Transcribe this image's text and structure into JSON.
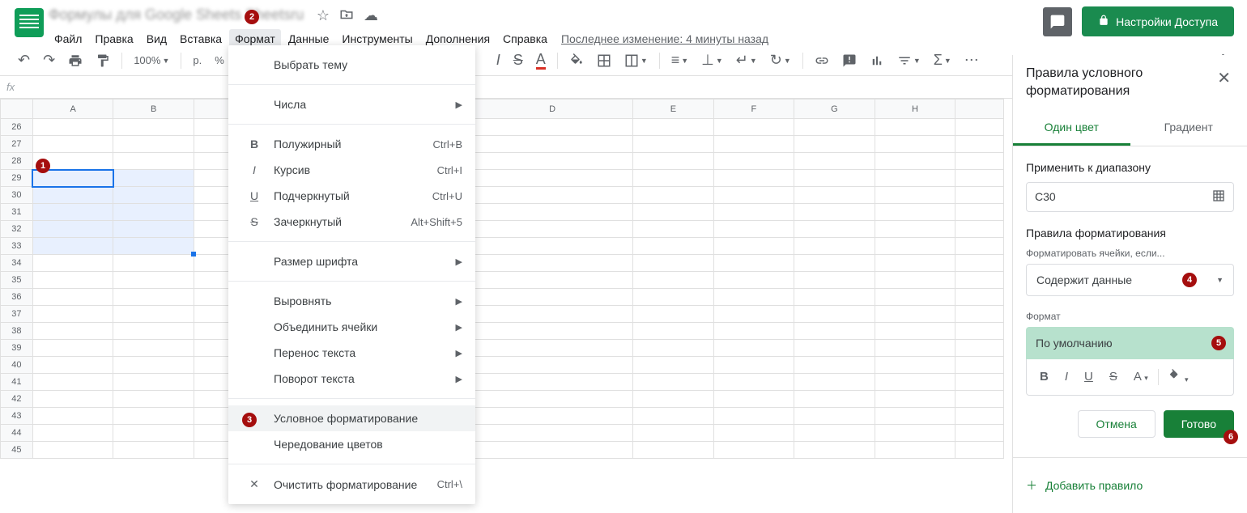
{
  "header": {
    "doc_title_blurred": "Формулы для Google Sheets Sheetsru",
    "star_icon": "☆",
    "move_icon": "⊕",
    "cloud_icon": "☁",
    "share_label": "Настройки Доступа",
    "last_edit": "Последнее изменение: 4 минуты назад"
  },
  "menubar": [
    "Файл",
    "Правка",
    "Вид",
    "Вставка",
    "Формат",
    "Данные",
    "Инструменты",
    "Дополнения",
    "Справка"
  ],
  "toolbar": {
    "zoom": "100%",
    "currency": "р.",
    "percent": "%"
  },
  "columns": [
    "A",
    "B",
    "",
    "D",
    "E",
    "F",
    "G",
    "H"
  ],
  "rows": [
    "26",
    "27",
    "28",
    "29",
    "30",
    "31",
    "32",
    "33",
    "34",
    "35",
    "36",
    "37",
    "38",
    "39",
    "40",
    "41",
    "42",
    "43",
    "44",
    "45"
  ],
  "format_menu": {
    "items": [
      {
        "label": "Выбрать тему",
        "icon": "",
        "shortcut": "",
        "arrow": false
      },
      {
        "sep": true
      },
      {
        "label": "Числа",
        "icon": "",
        "shortcut": "",
        "arrow": true
      },
      {
        "sep": true
      },
      {
        "label": "Полужирный",
        "icon": "B",
        "bold": true,
        "shortcut": "Ctrl+B",
        "arrow": false
      },
      {
        "label": "Курсив",
        "icon": "I",
        "italic": true,
        "shortcut": "Ctrl+I",
        "arrow": false
      },
      {
        "label": "Подчеркнутый",
        "icon": "U",
        "underline": true,
        "shortcut": "Ctrl+U",
        "arrow": false
      },
      {
        "label": "Зачеркнутый",
        "icon": "S",
        "strike": true,
        "shortcut": "Alt+Shift+5",
        "arrow": false
      },
      {
        "sep": true
      },
      {
        "label": "Размер шрифта",
        "icon": "",
        "shortcut": "",
        "arrow": true
      },
      {
        "sep": true
      },
      {
        "label": "Выровнять",
        "icon": "",
        "shortcut": "",
        "arrow": true
      },
      {
        "label": "Объединить ячейки",
        "icon": "",
        "shortcut": "",
        "arrow": true
      },
      {
        "label": "Перенос текста",
        "icon": "",
        "shortcut": "",
        "arrow": true
      },
      {
        "label": "Поворот текста",
        "icon": "",
        "shortcut": "",
        "arrow": true
      },
      {
        "sep": true
      },
      {
        "label": "Условное форматирование",
        "icon": "",
        "shortcut": "",
        "arrow": false,
        "hover": true
      },
      {
        "label": "Чередование цветов",
        "icon": "",
        "shortcut": "",
        "arrow": false
      },
      {
        "sep": true
      },
      {
        "label": "Очистить форматирование",
        "icon": "✕",
        "shortcut": "Ctrl+\\",
        "arrow": false
      }
    ]
  },
  "sidebar": {
    "title": "Правила условного форматирования",
    "tabs": {
      "single": "Один цвет",
      "gradient": "Градиент"
    },
    "apply_label": "Применить к диапазону",
    "range_value": "C30",
    "rules_label": "Правила форматирования",
    "format_if_label": "Форматировать ячейки, если...",
    "condition_value": "Содержит данные",
    "format_label": "Формат",
    "preview_text": "По умолчанию",
    "cancel": "Отмена",
    "done": "Готово",
    "add_rule": "Добавить правило"
  },
  "annotations": {
    "1": "1",
    "2": "2",
    "3": "3",
    "4": "4",
    "5": "5",
    "6": "6"
  }
}
